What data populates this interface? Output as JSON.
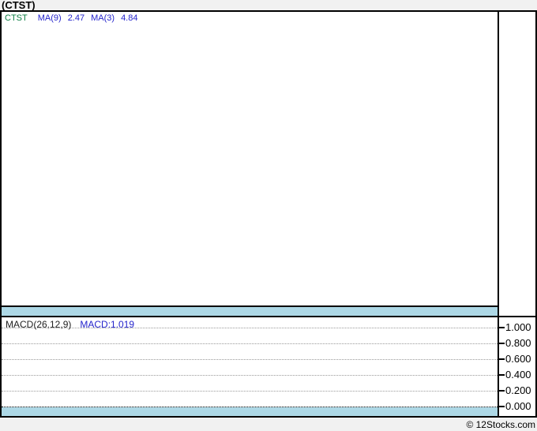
{
  "title": "(CTST)",
  "main_panel": {
    "legend": {
      "symbol": "CTST",
      "ma9_label": "MA(9)",
      "ma9_value": "2.47",
      "ma3_label": "MA(3)",
      "ma3_value": "4.84"
    }
  },
  "macd_panel": {
    "label": "MACD(26,12,9)",
    "value_label": "MACD:1.019",
    "axis_ticks": [
      "1.000",
      "0.800",
      "0.600",
      "0.400",
      "0.200",
      "0.000"
    ]
  },
  "footer": {
    "copyright": "© 12Stocks.com"
  },
  "colors": {
    "page_bg": "#f1f1f1",
    "ink": "#000000",
    "symbol_green": "#0a7d42",
    "accent_blue": "#2424cc",
    "macd_label": "#222222",
    "grid_gray": "#9a9a9a",
    "band_blue": "#ADD8E6"
  },
  "chart_data": [
    {
      "type": "line",
      "title": "(CTST)",
      "panel": "price",
      "series": [
        {
          "name": "CTST",
          "color_key": "symbol_green",
          "values": []
        },
        {
          "name": "MA(9)",
          "last_value": 2.47,
          "color_key": "accent_blue",
          "values": []
        },
        {
          "name": "MA(3)",
          "last_value": 4.84,
          "color_key": "accent_blue",
          "values": []
        }
      ],
      "legend_position": "top-left",
      "grid": false,
      "note": "panel is empty - no price data plotted"
    },
    {
      "type": "line",
      "panel": "MACD(26,12,9)",
      "series": [
        {
          "name": "MACD",
          "last_value": 1.019,
          "values": []
        }
      ],
      "yticks": [
        1.0,
        0.8,
        0.6,
        0.4,
        0.2,
        0.0
      ],
      "ylabel": "",
      "axis_side": "right",
      "grid": "dotted horizontal",
      "legend_position": "top-left",
      "note": "panel is empty - no MACD data plotted"
    }
  ]
}
